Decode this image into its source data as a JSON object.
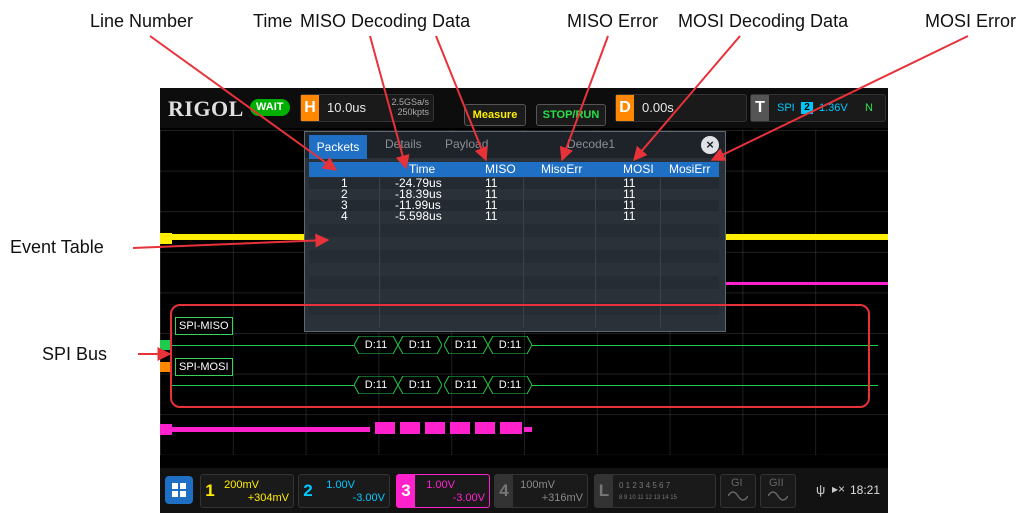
{
  "annotations": {
    "line_number": "Line Number",
    "time": "Time",
    "miso_decoding_data": "MISO Decoding Data",
    "miso_error": "MISO Error",
    "mosi_decoding_data": "MOSI Decoding Data",
    "mosi_error": "MOSI Error",
    "event_table": "Event Table",
    "spi_bus": "SPI  Bus"
  },
  "topbar": {
    "logo": "RIGOL",
    "status": "WAIT",
    "h_label": "H",
    "h_value": "10.0us",
    "sample_rate": "2.5GSa/s",
    "mem_depth": "250kpts",
    "measure_label": "Measure",
    "stop_run_label": "STOP/RUN",
    "d_label": "D",
    "d_value": "0.00s",
    "t_label": "T",
    "trigger_type": "SPI",
    "trigger_source": "2",
    "trigger_level": "1.36V",
    "trigger_mode": "N"
  },
  "decode_window": {
    "tabs": [
      "Packets",
      "Details",
      "Payload"
    ],
    "title": "Decode1",
    "close": "×",
    "columns": [
      "",
      "Time",
      "MISO",
      "MisoErr",
      "MOSI",
      "MosiErr"
    ],
    "rows": [
      [
        "1",
        "-24.79us",
        "11",
        "",
        "11",
        ""
      ],
      [
        "2",
        "-18.39us",
        "11",
        "",
        "11",
        ""
      ],
      [
        "3",
        "-11.99us",
        "11",
        "",
        "11",
        ""
      ],
      [
        "4",
        "-5.598us",
        "11",
        "",
        "11",
        ""
      ]
    ]
  },
  "bus": {
    "miso_label": "SPI-MISO",
    "mosi_label": "SPI-MOSI",
    "miso_frames": [
      "D:11",
      "D:11",
      "D:11",
      "D:11"
    ],
    "mosi_frames": [
      "D:11",
      "D:11",
      "D:11",
      "D:11"
    ]
  },
  "bottombar": {
    "ch1": {
      "num": "1",
      "scale": "200mV",
      "offset": "+304mV"
    },
    "ch2": {
      "num": "2",
      "scale": "1.00V",
      "offset": "-3.00V"
    },
    "ch3": {
      "num": "3",
      "scale": "1.00V",
      "offset": "-3.00V"
    },
    "ch4": {
      "num": "4",
      "scale": "100mV",
      "offset": "+316mV"
    },
    "la_label": "L",
    "la_channels_top": "0 1 2 3  4 5 6 7",
    "la_channels_bottom": "8 9 10 11 12 13 14 15",
    "g1_label": "GI",
    "g2_label": "GII",
    "clock": "18:21"
  },
  "colors": {
    "ch1": "#ffee00",
    "ch2": "#00c8ff",
    "ch3": "#ff22cc",
    "ch4": "#9a9a9a",
    "annotation_arrow": "#e8323a",
    "bus": "#1fcb4a",
    "table_header": "#1f6fc4"
  }
}
